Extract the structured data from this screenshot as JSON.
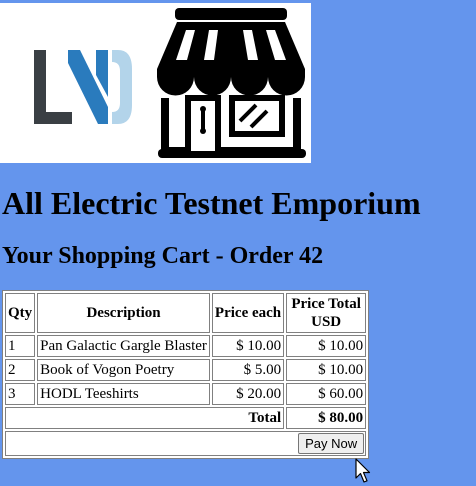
{
  "logo": {
    "icon_names": [
      "lnd-logo-icon",
      "storefront-icon"
    ],
    "colors": {
      "dark_gray": "#3a3f44",
      "blue": "#2a7bbd",
      "light_blue": "#b3d4ea"
    }
  },
  "page": {
    "title": "All Electric Testnet Emporium",
    "subtitle": "Your Shopping Cart - Order 42",
    "background_color": "#6495ed"
  },
  "cart": {
    "headers": {
      "qty": "Qty",
      "description": "Description",
      "price_each": "Price each",
      "price_total": "Price Total USD"
    },
    "rows": [
      {
        "qty": "1",
        "description": "Pan Galactic Gargle Blaster",
        "price_each": "$ 10.00",
        "price_total": "$ 10.00"
      },
      {
        "qty": "2",
        "description": "Book of Vogon Poetry",
        "price_each": "$ 5.00",
        "price_total": "$ 10.00"
      },
      {
        "qty": "3",
        "description": "HODL Teeshirts",
        "price_each": "$ 20.00",
        "price_total": "$ 60.00"
      }
    ],
    "total_label": "Total",
    "total_value": "$ 80.00",
    "pay_button_label": "Pay Now"
  }
}
